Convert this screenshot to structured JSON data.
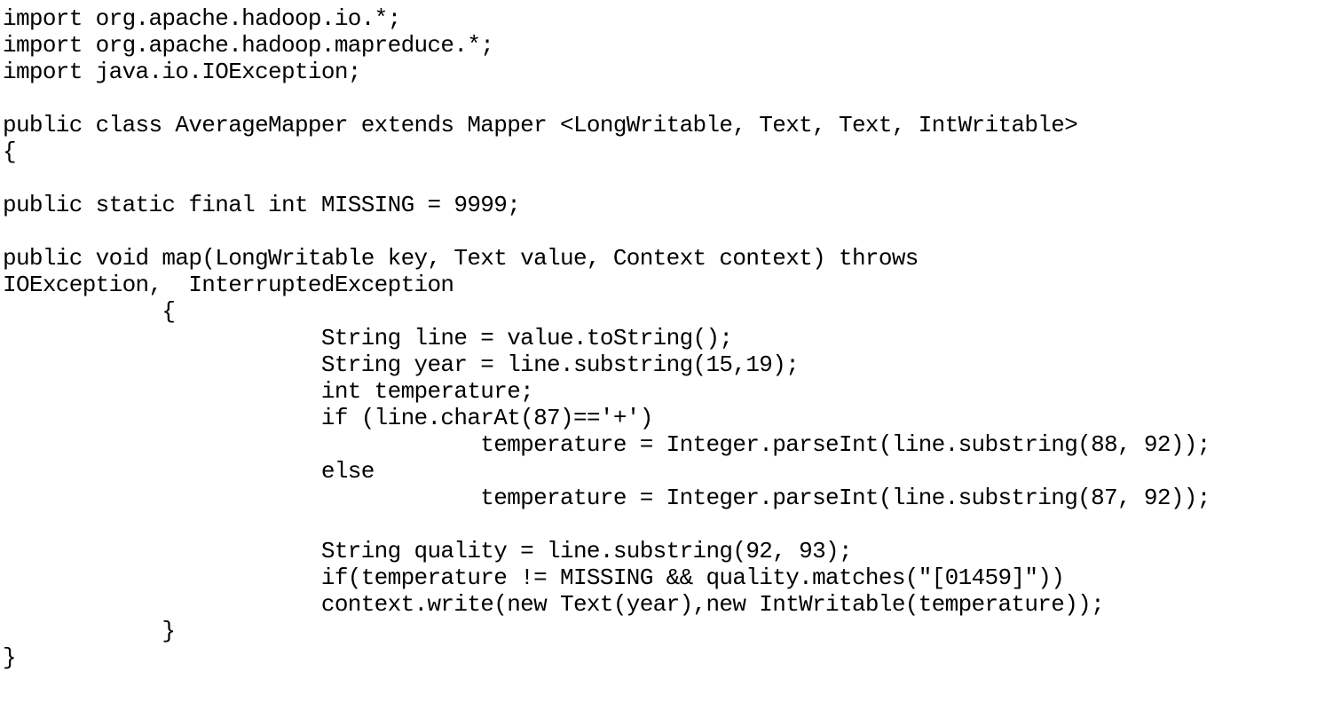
{
  "code": {
    "lines": [
      "import org.apache.hadoop.io.*;",
      "import org.apache.hadoop.mapreduce.*;",
      "import java.io.IOException;",
      "",
      "public class AverageMapper extends Mapper <LongWritable, Text, Text, IntWritable>",
      "{",
      "",
      "public static final int MISSING = 9999;",
      "",
      "public void map(LongWritable key, Text value, Context context) throws",
      "IOException,  InterruptedException",
      "            {",
      "                        String line = value.toString();",
      "                        String year = line.substring(15,19);",
      "                        int temperature;",
      "                        if (line.charAt(87)=='+')",
      "                                    temperature = Integer.parseInt(line.substring(88, 92));",
      "                        else",
      "                                    temperature = Integer.parseInt(line.substring(87, 92));",
      "",
      "                        String quality = line.substring(92, 93);",
      "                        if(temperature != MISSING && quality.matches(\"[01459]\"))",
      "                        context.write(new Text(year),new IntWritable(temperature));",
      "            }",
      "}"
    ]
  }
}
